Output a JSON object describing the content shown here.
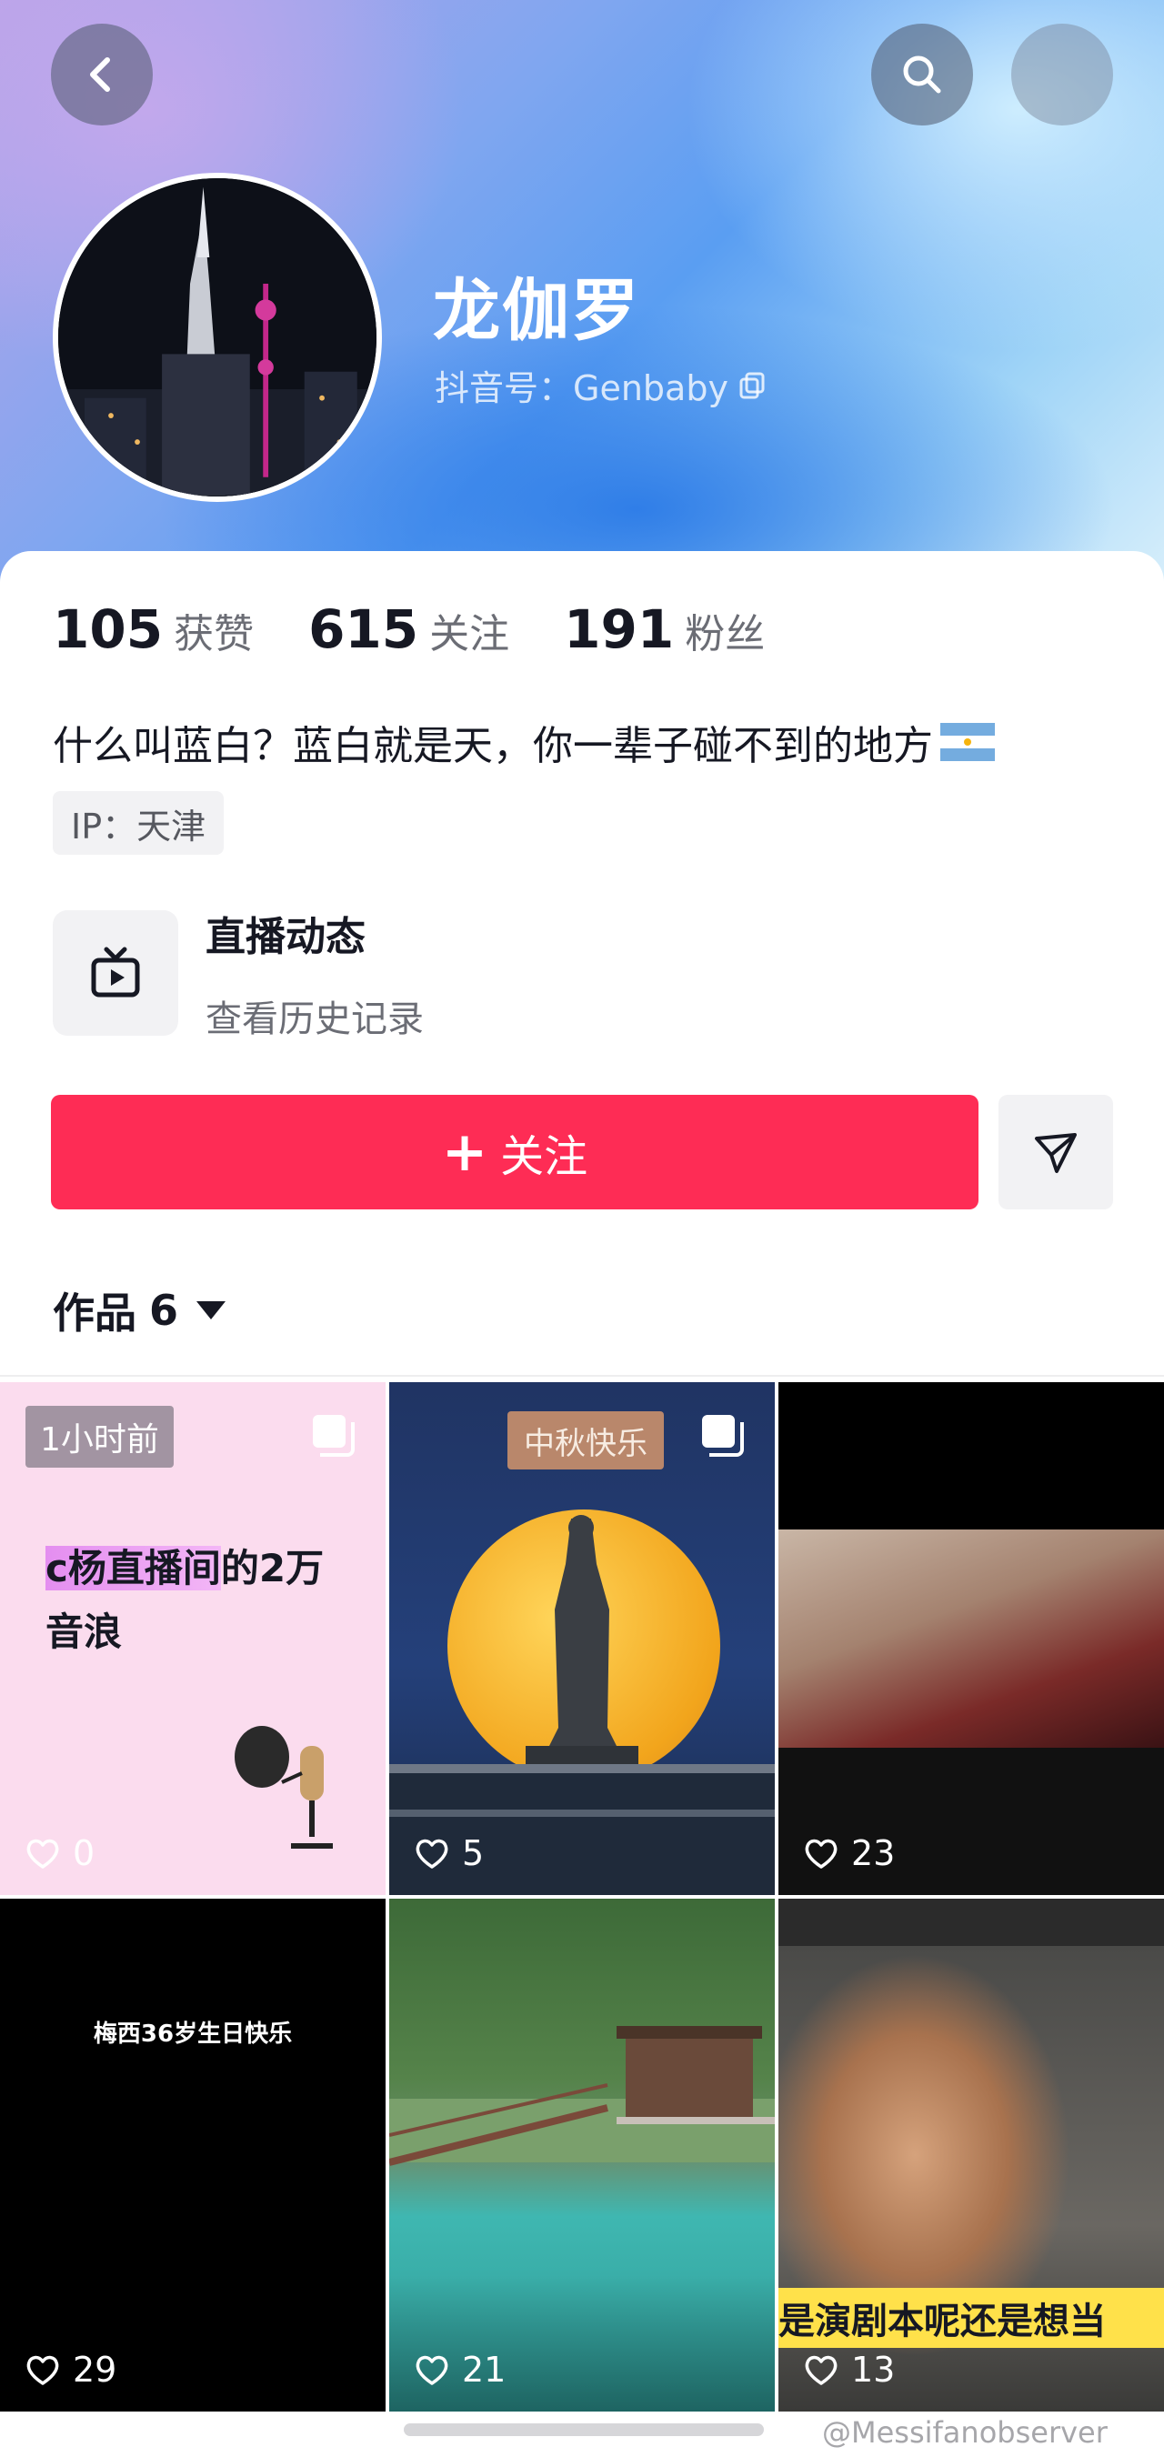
{
  "header": {
    "back_icon": "chevron-left-icon",
    "search_icon": "search-icon",
    "more_icon": "more-icon"
  },
  "profile": {
    "nickname": "龙伽罗",
    "douyin_id": "抖音号：Genbaby",
    "stats": [
      {
        "value": "105",
        "label": "获赞"
      },
      {
        "value": "615",
        "label": "关注"
      },
      {
        "value": "191",
        "label": "粉丝"
      }
    ],
    "bio": "什么叫蓝白？蓝白就是天，你一辈子碰不到的地方",
    "ip": "IP：天津"
  },
  "live": {
    "title": "直播动态",
    "subtitle": "查看历史记录"
  },
  "actions": {
    "follow_label": "关注",
    "follow_plus": "+"
  },
  "works": {
    "label": "作品",
    "count": "6"
  },
  "grid": [
    {
      "likes": "0",
      "badge": "1小时前",
      "title_highlight": "c杨直播间",
      "title_rest": "的2万音浪"
    },
    {
      "likes": "5",
      "badge": "中秋快乐"
    },
    {
      "likes": "23"
    },
    {
      "likes": "29",
      "text": "梅西36岁生日快乐"
    },
    {
      "likes": "21"
    },
    {
      "likes": "13",
      "caption": "是演剧本呢还是想当"
    }
  ],
  "watermark": "@Messifanobserver",
  "colors": {
    "accent": "#fe2c55",
    "text_primary": "#161823",
    "text_secondary": "#6b6d75"
  }
}
